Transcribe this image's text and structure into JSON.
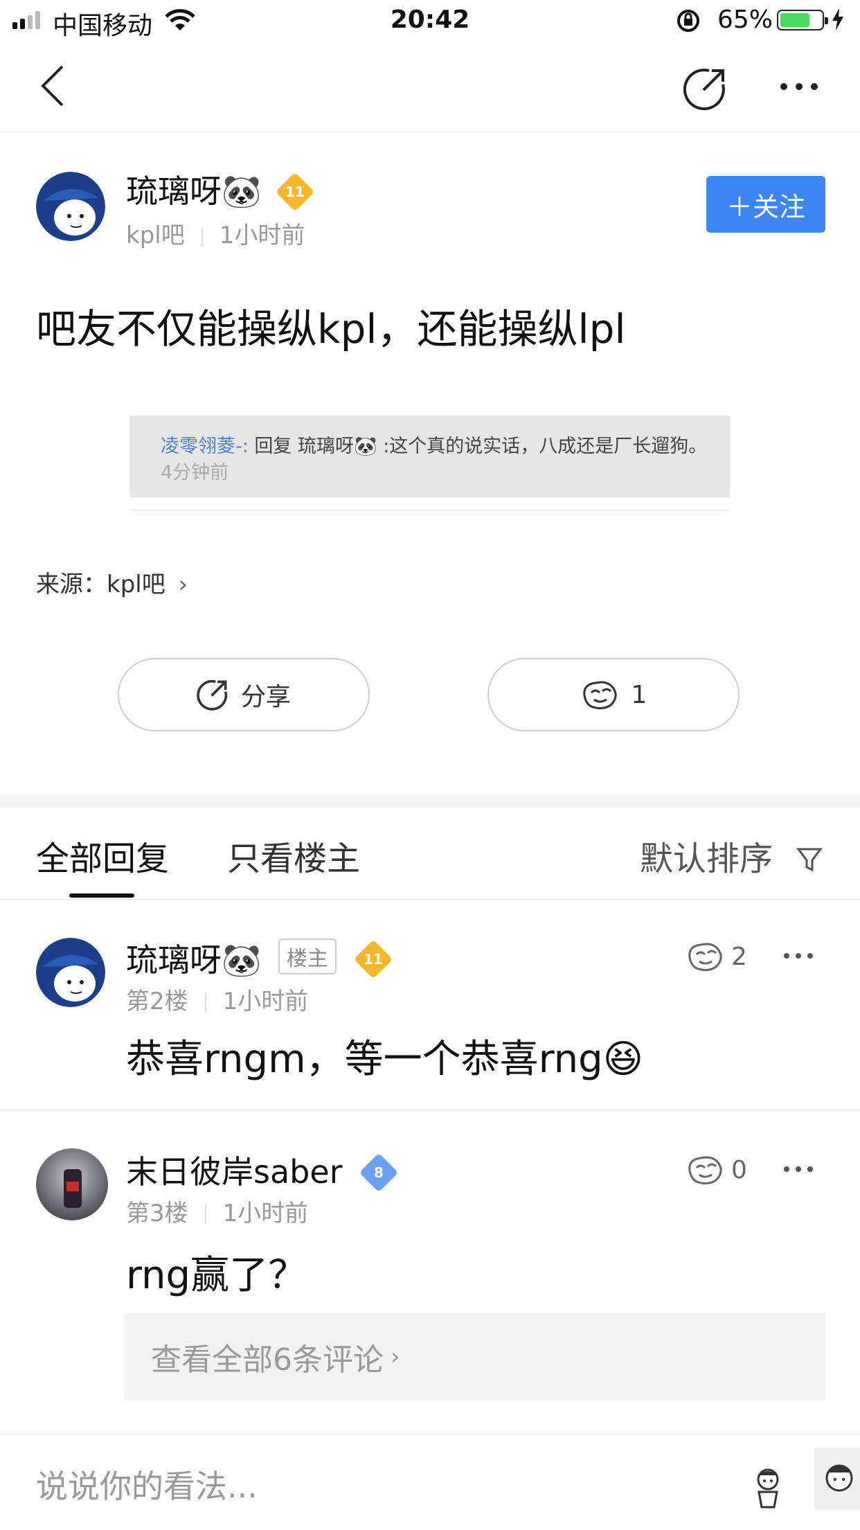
{
  "status_bar": {
    "carrier": "中国移动",
    "time": "20:42",
    "battery_percent": "65%",
    "battery_level": 0.65,
    "battery_color": "#4cd964"
  },
  "nav": {
    "back_icon": "chevron-left-icon",
    "share_icon": "share-icon",
    "more_icon": "more-dots-icon"
  },
  "post": {
    "author": "琉璃呀🐼",
    "level": "11",
    "forum": "kpl吧",
    "time": "1小时前",
    "follow_label": "＋关注",
    "title": "吧友不仅能操纵kpl，还能操纵lpl",
    "embedded": {
      "user": "凌零翎菱-:",
      "reply_prefix": " 回复 琉璃呀🐼 :这个真的说实话，八成还是厂长遛狗。",
      "time": "4分钟前"
    },
    "source_label": "来源：",
    "source_name": "kpl吧",
    "share_label": "分享",
    "like_count": "1"
  },
  "tabs": {
    "all": "全部回复",
    "owner_only": "只看楼主",
    "sort": "默认排序"
  },
  "replies": [
    {
      "author": "琉璃呀🐼",
      "tag": "楼主",
      "level": "11",
      "floor": "第2楼",
      "time": "1小时前",
      "content": "恭喜rngm，等一个恭喜rng😆",
      "likes": "2"
    },
    {
      "author": "末日彼岸saber",
      "level": "8",
      "floor": "第3楼",
      "time": "1小时前",
      "content": "rng赢了？",
      "likes": "0",
      "view_all": "查看全部6条评论"
    }
  ],
  "input": {
    "placeholder": "说说你的看法..."
  },
  "colors": {
    "accent": "#3d85f5",
    "level_gold": "#f5b72c",
    "level_blue": "#6b9ef5"
  }
}
